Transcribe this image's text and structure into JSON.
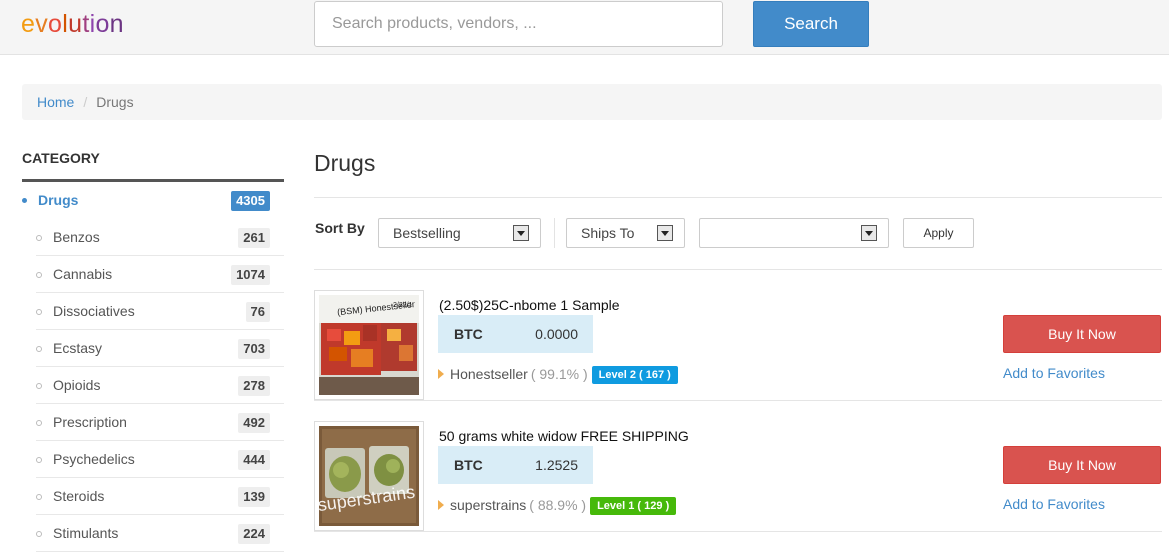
{
  "header": {
    "logo_letters": [
      {
        "ch": "e",
        "color": "#f39c12"
      },
      {
        "ch": "v",
        "color": "#e67e22"
      },
      {
        "ch": "o",
        "color": "#e74c3c"
      },
      {
        "ch": "l",
        "color": "#d35400"
      },
      {
        "ch": "u",
        "color": "#c0392b"
      },
      {
        "ch": "t",
        "color": "#a04080"
      },
      {
        "ch": "i",
        "color": "#8e44ad"
      },
      {
        "ch": "o",
        "color": "#7d3c98"
      },
      {
        "ch": "n",
        "color": "#6c3483"
      }
    ],
    "search_placeholder": "Search products, vendors, ...",
    "search_button": "Search"
  },
  "breadcrumb": {
    "home": "Home",
    "separator": "/",
    "current": "Drugs"
  },
  "sidebar": {
    "title": "CATEGORY",
    "active": {
      "label": "Drugs",
      "count": "4305"
    },
    "items": [
      {
        "label": "Benzos",
        "count": "261"
      },
      {
        "label": "Cannabis",
        "count": "1074"
      },
      {
        "label": "Dissociatives",
        "count": "76"
      },
      {
        "label": "Ecstasy",
        "count": "703"
      },
      {
        "label": "Opioids",
        "count": "278"
      },
      {
        "label": "Prescription",
        "count": "492"
      },
      {
        "label": "Psychedelics",
        "count": "444"
      },
      {
        "label": "Steroids",
        "count": "139"
      },
      {
        "label": "Stimulants",
        "count": "224"
      }
    ]
  },
  "main": {
    "title": "Drugs",
    "sort": {
      "label": "Sort By",
      "sort_value": "Bestselling",
      "ships_to": "Ships To",
      "ships_value": "",
      "apply": "Apply"
    },
    "listings": [
      {
        "title": "(2.50$)25C-nbome 1 Sample",
        "currency": "BTC",
        "price": "0.0000",
        "vendor": "Honestseller",
        "rating": "( 99.1% )",
        "level": "Level 2 ( 167 )",
        "level_color": "#0f9be0",
        "buy": "Buy It Now",
        "favorite": "Add to Favorites",
        "thumb_caption": "(BSM) Honestseller",
        "thumb_date": "2/22/1"
      },
      {
        "title": "50 grams white widow FREE SHIPPING",
        "currency": "BTC",
        "price": "1.2525",
        "vendor": "superstrains",
        "rating": "( 88.9% )",
        "level": "Level 1 ( 129 )",
        "level_color": "#46b90a",
        "buy": "Buy It Now",
        "favorite": "Add to Favorites",
        "thumb_caption": "superstrains"
      }
    ]
  }
}
